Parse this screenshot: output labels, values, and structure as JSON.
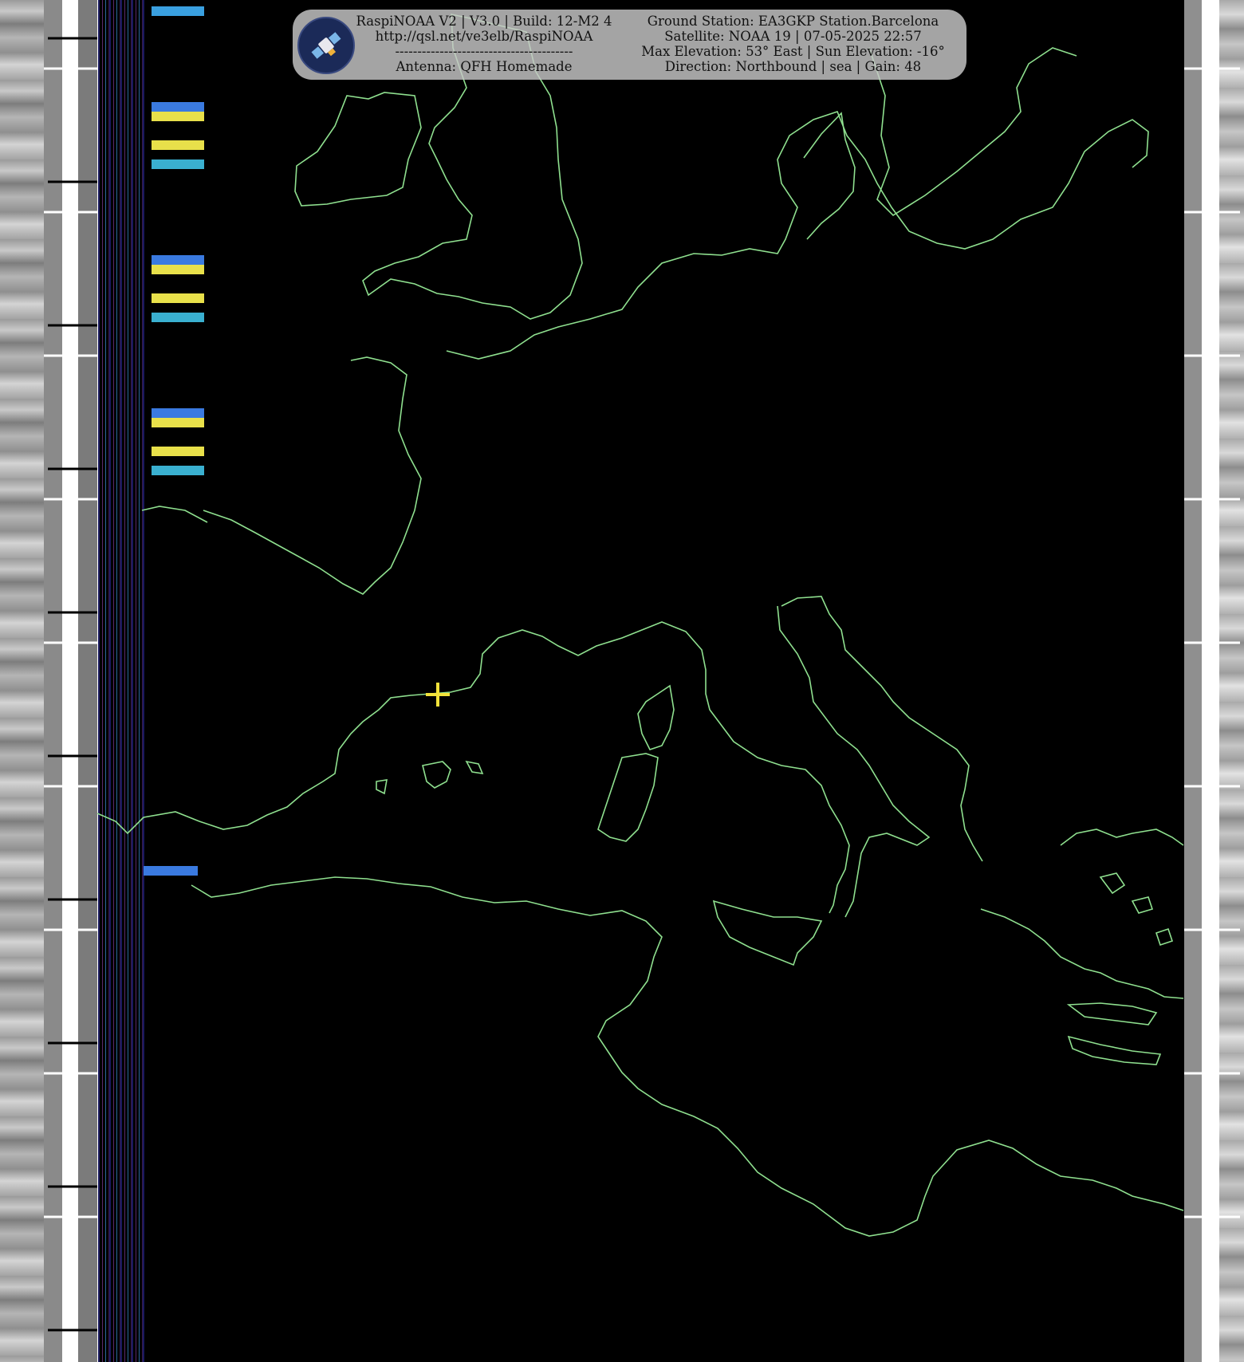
{
  "header": {
    "left": {
      "line1": "RaspiNOAA V2 | V3.0 | Build: 12-M2 4",
      "line2": "http://qsl.net/ve3elb/RaspiNOAA",
      "line3": "----------------------------------------",
      "line4": "Antenna: QFH Homemade"
    },
    "right": {
      "line1": "Ground Station: EA3GKP Station.Barcelona",
      "line2": "Satellite: NOAA 19 | 07-05-2025 22:57",
      "line3": "Max Elevation: 53° East | Sun Elevation: -16°",
      "line4": "Direction: Northbound | sea | Gain: 48"
    },
    "logo_icon": "satellite-icon"
  },
  "colors": {
    "coastline": "#8fe08f",
    "marker": "#f2e23a",
    "background": "#000000",
    "header_bg": "#c8c8c8"
  },
  "marker_icon": "station-crosshair-icon"
}
